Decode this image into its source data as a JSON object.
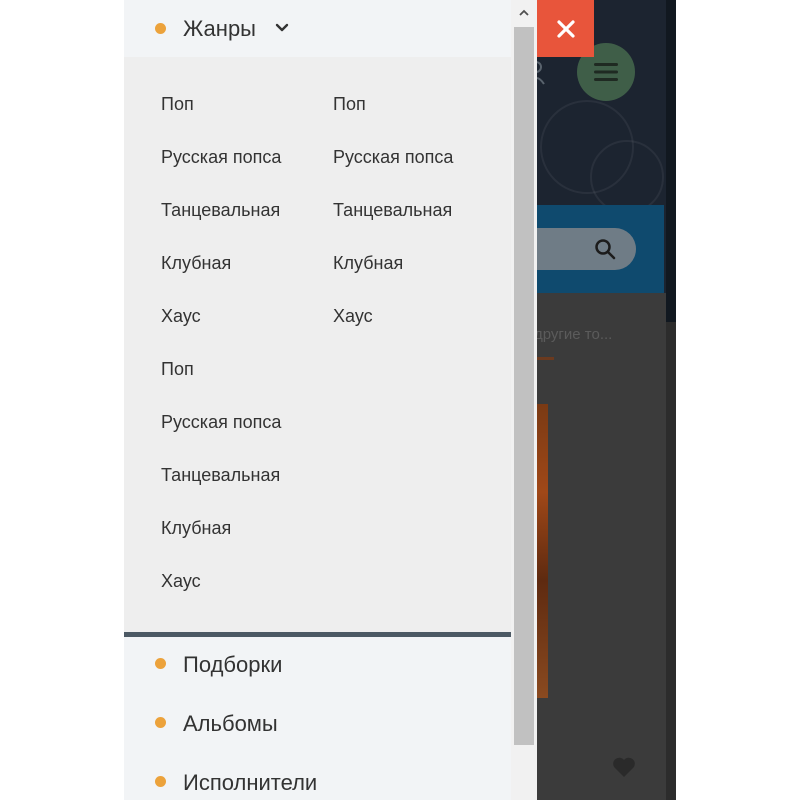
{
  "menu": {
    "section_title": "Жанры",
    "genres_column_a": [
      "Поп",
      "Русская попса",
      "Танцевальная",
      "Клубная",
      "Хаус",
      "Поп",
      "Русская попса",
      "Танцевальная",
      "Клубная",
      "Хаус"
    ],
    "genres_column_b": [
      "Поп",
      "Русская попса",
      "Танцевальная",
      "Клубная",
      "Хаус"
    ],
    "sections": [
      "Подборки",
      "Альбомы",
      "Исполнители"
    ]
  },
  "background_page": {
    "faded_text": "другие то..."
  },
  "icons": {
    "close": "close-icon",
    "chevron": "chevron-down-icon",
    "menu": "hamburger-menu-icon",
    "search": "search-icon",
    "user": "user-icon",
    "heart": "heart-icon",
    "scroll_up": "scroll-up-arrow-icon"
  },
  "colors": {
    "accent_orange": "#eca23b",
    "close_red": "#e8553b",
    "panel_bg": "#eeeeee",
    "divider": "#4c5964",
    "menu_button_green": "#3f5e48"
  }
}
